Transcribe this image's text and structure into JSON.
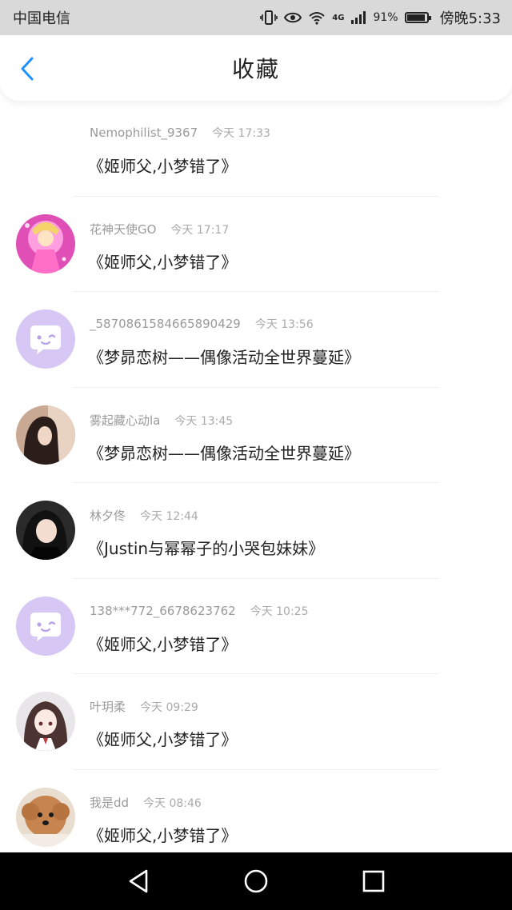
{
  "status_bar": {
    "carrier": "中国电信",
    "network": "4G",
    "battery_percent": "91%",
    "time": "傍晚5:33"
  },
  "header": {
    "title": "收藏"
  },
  "items": [
    {
      "user": "Nemophilist_9367",
      "time": "今天 17:33",
      "title": "《姬师父,小梦错了》",
      "avatar": "none"
    },
    {
      "user": "花神天使GO",
      "time": "今天 17:17",
      "title": "《姬师父,小梦错了》",
      "avatar": "anime-pink"
    },
    {
      "user": "_5870861584665890429",
      "time": "今天 13:56",
      "title": "《梦昴恋树——偶像活动全世界蔓延》",
      "avatar": "default-chat"
    },
    {
      "user": "雾起藏心动la",
      "time": "今天 13:45",
      "title": "《梦昴恋树——偶像活动全世界蔓延》",
      "avatar": "photo-girl"
    },
    {
      "user": "林夕佟",
      "time": "今天 12:44",
      "title": "《Justin与幂幂子的小哭包妹妹》",
      "avatar": "photo-dark"
    },
    {
      "user": "138***772_6678623762",
      "time": "今天 10:25",
      "title": "《姬师父,小梦错了》",
      "avatar": "default-chat"
    },
    {
      "user": "叶玥柔",
      "time": "今天 09:29",
      "title": "《姬师父,小梦错了》",
      "avatar": "anime-girl"
    },
    {
      "user": "我是dd",
      "time": "今天 08:46",
      "title": "《姬师父,小梦错了》",
      "avatar": "puppy"
    }
  ],
  "colors": {
    "accent": "#1e90ff",
    "default_avatar_bg": "#d7c7f5"
  },
  "nav_icons": [
    "back-triangle-icon",
    "home-circle-icon",
    "recent-square-icon"
  ]
}
